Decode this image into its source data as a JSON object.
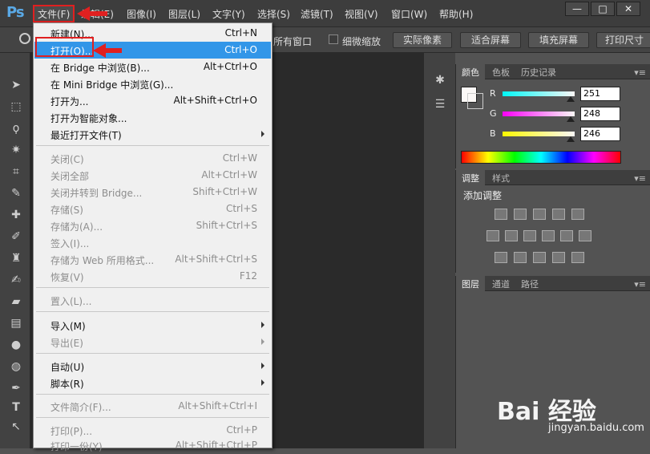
{
  "app_logo": "Ps",
  "menubar": {
    "items": [
      "文件(F)",
      "编辑(E)",
      "图像(I)",
      "图层(L)",
      "文字(Y)",
      "选择(S)",
      "滤镜(T)",
      "视图(V)",
      "窗口(W)",
      "帮助(H)"
    ],
    "window_controls": [
      "—",
      "□",
      "✕"
    ]
  },
  "options_bar": {
    "partial_label": "所有窗口",
    "scrubby_zoom_label": "细微缩放",
    "buttons": [
      "实际像素",
      "适合屏幕",
      "填充屏幕",
      "打印尺寸"
    ]
  },
  "file_menu": {
    "items": [
      {
        "label": "新建(N)...",
        "shortcut": "Ctrl+N",
        "disabled": false
      },
      {
        "label": "打开(O)...",
        "shortcut": "Ctrl+O",
        "disabled": false,
        "highlighted": true
      },
      {
        "label": "在 Bridge 中浏览(B)...",
        "shortcut": "Alt+Ctrl+O",
        "disabled": false
      },
      {
        "label": "在 Mini Bridge 中浏览(G)...",
        "shortcut": "",
        "disabled": false
      },
      {
        "label": "打开为...",
        "shortcut": "Alt+Shift+Ctrl+O",
        "disabled": false
      },
      {
        "label": "打开为智能对象...",
        "shortcut": "",
        "disabled": false
      },
      {
        "label": "最近打开文件(T)",
        "shortcut": "",
        "disabled": false,
        "submenu": true
      },
      {
        "label": "关闭(C)",
        "shortcut": "Ctrl+W",
        "disabled": true
      },
      {
        "label": "关闭全部",
        "shortcut": "Alt+Ctrl+W",
        "disabled": true
      },
      {
        "label": "关闭并转到 Bridge...",
        "shortcut": "Shift+Ctrl+W",
        "disabled": true
      },
      {
        "label": "存储(S)",
        "shortcut": "Ctrl+S",
        "disabled": true
      },
      {
        "label": "存储为(A)...",
        "shortcut": "Shift+Ctrl+S",
        "disabled": true
      },
      {
        "label": "签入(I)...",
        "shortcut": "",
        "disabled": true
      },
      {
        "label": "存储为 Web 所用格式...",
        "shortcut": "Alt+Shift+Ctrl+S",
        "disabled": true
      },
      {
        "label": "恢复(V)",
        "shortcut": "F12",
        "disabled": true
      },
      {
        "label": "置入(L)...",
        "shortcut": "",
        "disabled": true
      },
      {
        "label": "导入(M)",
        "shortcut": "",
        "disabled": false,
        "submenu": true
      },
      {
        "label": "导出(E)",
        "shortcut": "",
        "disabled": true,
        "submenu": true
      },
      {
        "label": "自动(U)",
        "shortcut": "",
        "disabled": false,
        "submenu": true
      },
      {
        "label": "脚本(R)",
        "shortcut": "",
        "disabled": false,
        "submenu": true
      },
      {
        "label": "文件简介(F)...",
        "shortcut": "Alt+Shift+Ctrl+I",
        "disabled": true
      },
      {
        "label": "打印(P)...",
        "shortcut": "Ctrl+P",
        "disabled": true
      },
      {
        "label": "打印一份(Y)",
        "shortcut": "Alt+Shift+Ctrl+P",
        "disabled": true
      }
    ]
  },
  "color_panel": {
    "tabs": [
      "颜色",
      "色板",
      "历史记录"
    ],
    "channels": [
      {
        "label": "R",
        "value": "251"
      },
      {
        "label": "G",
        "value": "248"
      },
      {
        "label": "B",
        "value": "246"
      }
    ]
  },
  "adjustments_panel": {
    "tabs": [
      "调整",
      "样式"
    ],
    "title": "添加调整"
  },
  "layers_panel": {
    "tabs": [
      "图层",
      "通道",
      "路径"
    ]
  },
  "watermark": {
    "brand": "Bai 经验",
    "url": "jingyan.baidu.com"
  },
  "colors": {
    "highlight": "#3296e8",
    "annotation_red": "#e02020"
  }
}
